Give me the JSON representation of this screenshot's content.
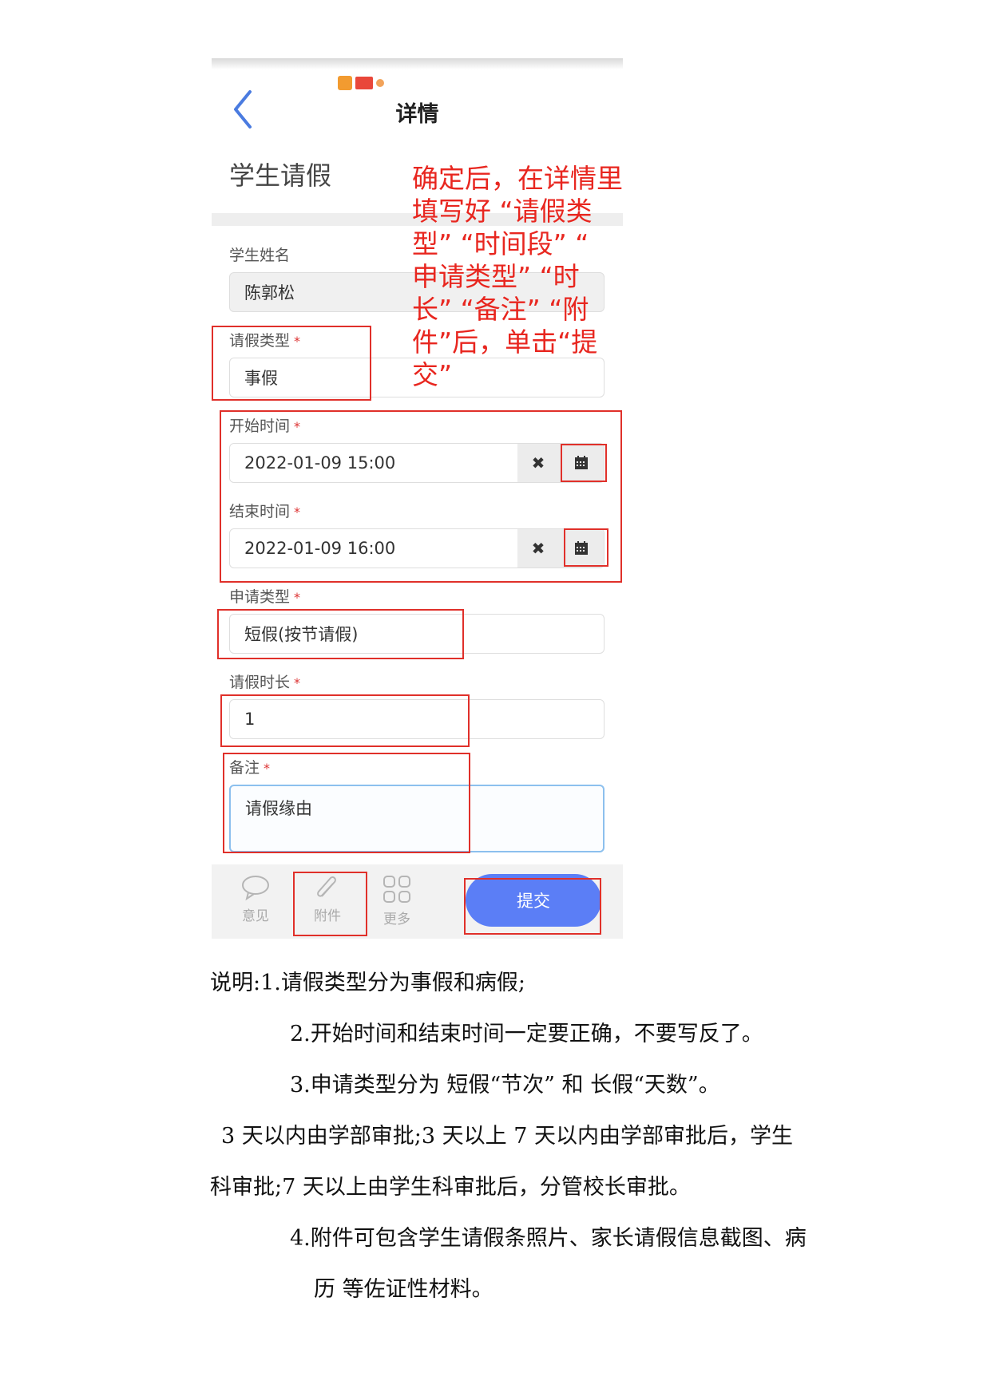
{
  "header": {
    "title": "详情"
  },
  "form": {
    "title": "学生请假",
    "fields": {
      "student_name": {
        "label": "学生姓名",
        "value": "陈郭松"
      },
      "leave_type": {
        "label": "请假类型",
        "required": "*",
        "value": "事假"
      },
      "start_time": {
        "label": "开始时间",
        "required": "*",
        "value": "2022-01-09 15:00"
      },
      "end_time": {
        "label": "结束时间",
        "required": "*",
        "value": "2022-01-09 16:00"
      },
      "apply_type": {
        "label": "申请类型",
        "required": "*",
        "value": "短假(按节请假)"
      },
      "duration": {
        "label": "请假时长",
        "required": "*",
        "value": "1"
      },
      "remark": {
        "label": "备注",
        "required": "*",
        "value": "请假缘由"
      }
    }
  },
  "toolbar": {
    "comment_label": "意见",
    "attachment_label": "附件",
    "more_label": "更多",
    "submit_label": "提交"
  },
  "annotation": {
    "lines": [
      "确定后，在详情里",
      "填写好 “请假类",
      "型” “时间段” “",
      "申请类型” “时",
      "长” “备注” “附",
      "件”后，单击“提",
      "交”"
    ]
  },
  "notes": {
    "lines": [
      "说明:1.请假类型分为事假和病假;",
      "2.开始时间和结束时间一定要正确，不要写反了。",
      "3.申请类型分为  短假“节次”    和  长假“天数”。",
      "3 天以内由学部审批;3 天以上 7 天以内由学部审批后，学生",
      "科审批;7 天以上由学生科审批后，分管校长审批。",
      "4.附件可包含学生请假条照片、家长请假信息截图、病",
      "历  等佐证性材料。"
    ]
  },
  "colors": {
    "accent": "#5b7ef6",
    "annotation": "#e8261f",
    "required": "#dd3333"
  }
}
